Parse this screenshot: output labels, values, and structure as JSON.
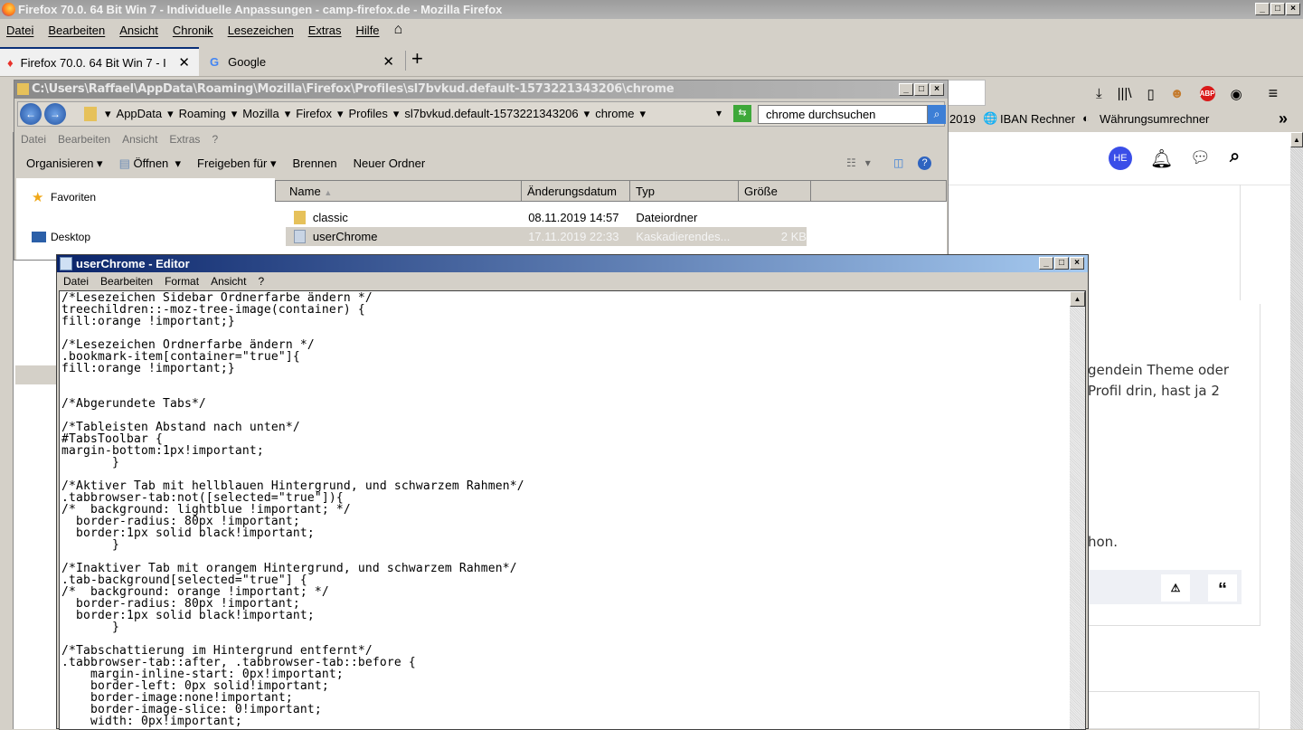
{
  "firefox": {
    "title": "Firefox 70.0. 64 Bit Win 7 - Individuelle Anpassungen - camp-firefox.de - Mozilla Firefox",
    "menu": [
      "Datei",
      "Bearbeiten",
      "Ansicht",
      "Chronik",
      "Lesezeichen",
      "Extras",
      "Hilfe"
    ],
    "tabs": [
      {
        "label": "Firefox 70.0. 64 Bit Win 7 - I"
      },
      {
        "label": "Google"
      }
    ],
    "bookmarks": [
      {
        "label": "2019"
      },
      {
        "label": "IBAN Rechner"
      },
      {
        "label": "Währungsumrechner"
      }
    ],
    "toolbar_icons": [
      "download-icon",
      "library-icon",
      "sidebar-icon",
      "greasemonkey-icon",
      "adblock-plus-icon",
      "account-icon",
      "hamburger-menu-icon"
    ],
    "abp_label": "ABP"
  },
  "web": {
    "avatar": "HE",
    "text1": "gendein Theme oder",
    "text2": "Profil drin, hast ja 2",
    "text3": "hon.",
    "avatar_color": "#3a4ee8"
  },
  "explorer": {
    "title": "C:\\Users\\Raffael\\AppData\\Roaming\\Mozilla\\Firefox\\Profiles\\sl7bvkud.default-1573221343206\\chrome",
    "breadcrumbs": [
      "AppData",
      "Roaming",
      "Mozilla",
      "Firefox",
      "Profiles",
      "sl7bvkud.default-1573221343206",
      "chrome"
    ],
    "search_placeholder": "chrome durchsuchen",
    "menu": [
      "Datei",
      "Bearbeiten",
      "Ansicht",
      "Extras",
      "?"
    ],
    "toolbar": {
      "organize": "Organisieren",
      "open": "Öffnen",
      "share": "Freigeben für",
      "burn": "Brennen",
      "new_folder": "Neuer Ordner"
    },
    "nav": {
      "favorites": "Favoriten",
      "desktop": "Desktop"
    },
    "columns": [
      "Name",
      "Änderungsdatum",
      "Typ",
      "Größe"
    ],
    "files": [
      {
        "name": "classic",
        "date": "08.11.2019 14:57",
        "type": "Dateiordner",
        "size": ""
      },
      {
        "name": "userChrome",
        "date": "17.11.2019 22:33",
        "type": "Kaskadierendes...",
        "size": "2 KB"
      }
    ]
  },
  "notepad": {
    "title": "userChrome - Editor",
    "menu": [
      "Datei",
      "Bearbeiten",
      "Format",
      "Ansicht",
      "?"
    ],
    "content": "/*Lesezeichen Sidebar Ordnerfarbe ändern */\ntreechildren::-moz-tree-image(container) {\nfill:orange !important;}\n\n/*Lesezeichen Ordnerfarbe ändern */\n.bookmark-item[container=\"true\"]{\nfill:orange !important;}\n\n\n/*Abgerundete Tabs*/\n\n/*Tableisten Abstand nach unten*/\n#TabsToolbar {\nmargin-bottom:1px!important;\n       }\n\n/*Aktiver Tab mit hellblauen Hintergrund, und schwarzem Rahmen*/\n.tabbrowser-tab:not([selected=\"true\"]){\n/*  background: lightblue !important; */\n  border-radius: 80px !important;\n  border:1px solid black!important;\n       }\n\n/*Inaktiver Tab mit orangem Hintergrund, und schwarzem Rahmen*/\n.tab-background[selected=\"true\"] {\n/*  background: orange !important; */\n  border-radius: 80px !important;\n  border:1px solid black!important;\n       }\n\n/*Tabschattierung im Hintergrund entfernt*/\n.tabbrowser-tab::after, .tabbrowser-tab::before {\n    margin-inline-start: 0px!important;\n    border-left: 0px solid!important;\n    border-image:none!important;\n    border-image-slice: 0!important;\n    width: 0px!important;"
  }
}
